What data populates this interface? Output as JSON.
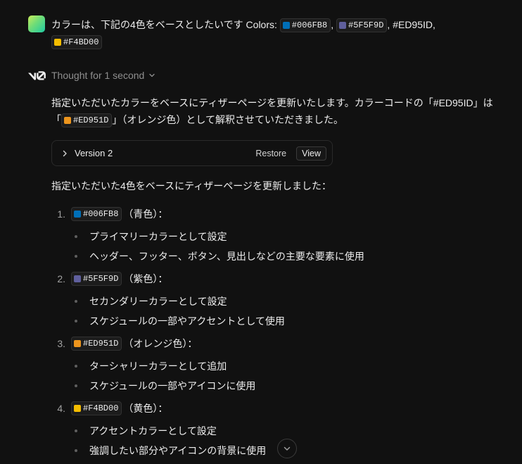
{
  "user_message": {
    "text_main": "カラーは、下記の4色をベースとしたいです Colors: ",
    "chip_1": {
      "label": "#006FB8",
      "swatch": "#006FB8"
    },
    "separator": ", ",
    "chip_2": {
      "label": "#5F5F9D",
      "swatch": "#5F5F9D"
    },
    "text_tail": ", #ED95ID,",
    "chip_3": {
      "label": "#F4BD00",
      "swatch": "#F4BD00"
    }
  },
  "assistant": {
    "thought_label": "Thought for 1 second",
    "intro": {
      "line_1": "指定いただいたカラーをベースにティザーページを更新いたします。カラーコードの「#ED95ID」は",
      "open_bracket": "「",
      "chip": {
        "label": "#ED951D",
        "swatch": "#ED951D"
      },
      "line_2_tail": "」（オレンジ色）として解釈させていただきました。"
    },
    "version_card": {
      "title": "Version 2",
      "restore_label": "Restore",
      "view_label": "View"
    },
    "summary": "指定いただいた4色をベースにティザーページを更新しました：",
    "colors": [
      {
        "number": "1.",
        "code": "#006FB8",
        "swatch": "#006FB8",
        "name": "（青色）：",
        "bullets": [
          "プライマリーカラーとして設定",
          "ヘッダー、フッター、ボタン、見出しなどの主要な要素に使用"
        ]
      },
      {
        "number": "2.",
        "code": "#5F5F9D",
        "swatch": "#5F5F9D",
        "name": "（紫色）：",
        "bullets": [
          "セカンダリーカラーとして設定",
          "スケジュールの一部やアクセントとして使用"
        ]
      },
      {
        "number": "3.",
        "code": "#ED951D",
        "swatch": "#ED951D",
        "name": "（オレンジ色）：",
        "bullets": [
          "ターシャリーカラーとして追加",
          "スケジュールの一部やアイコンに使用"
        ]
      },
      {
        "number": "4.",
        "code": "#F4BD00",
        "swatch": "#F4BD00",
        "name": "（黄色）：",
        "bullets": [
          "アクセントカラーとして設定",
          "強調したい部分やアイコンの背景に使用"
        ]
      }
    ]
  },
  "icons": {
    "avatar": "user-avatar",
    "logo": "v0-logo",
    "thought_toggle": "chevron-down-icon",
    "version_expand": "chevron-right-icon",
    "scroll_down": "chevron-down-icon"
  }
}
